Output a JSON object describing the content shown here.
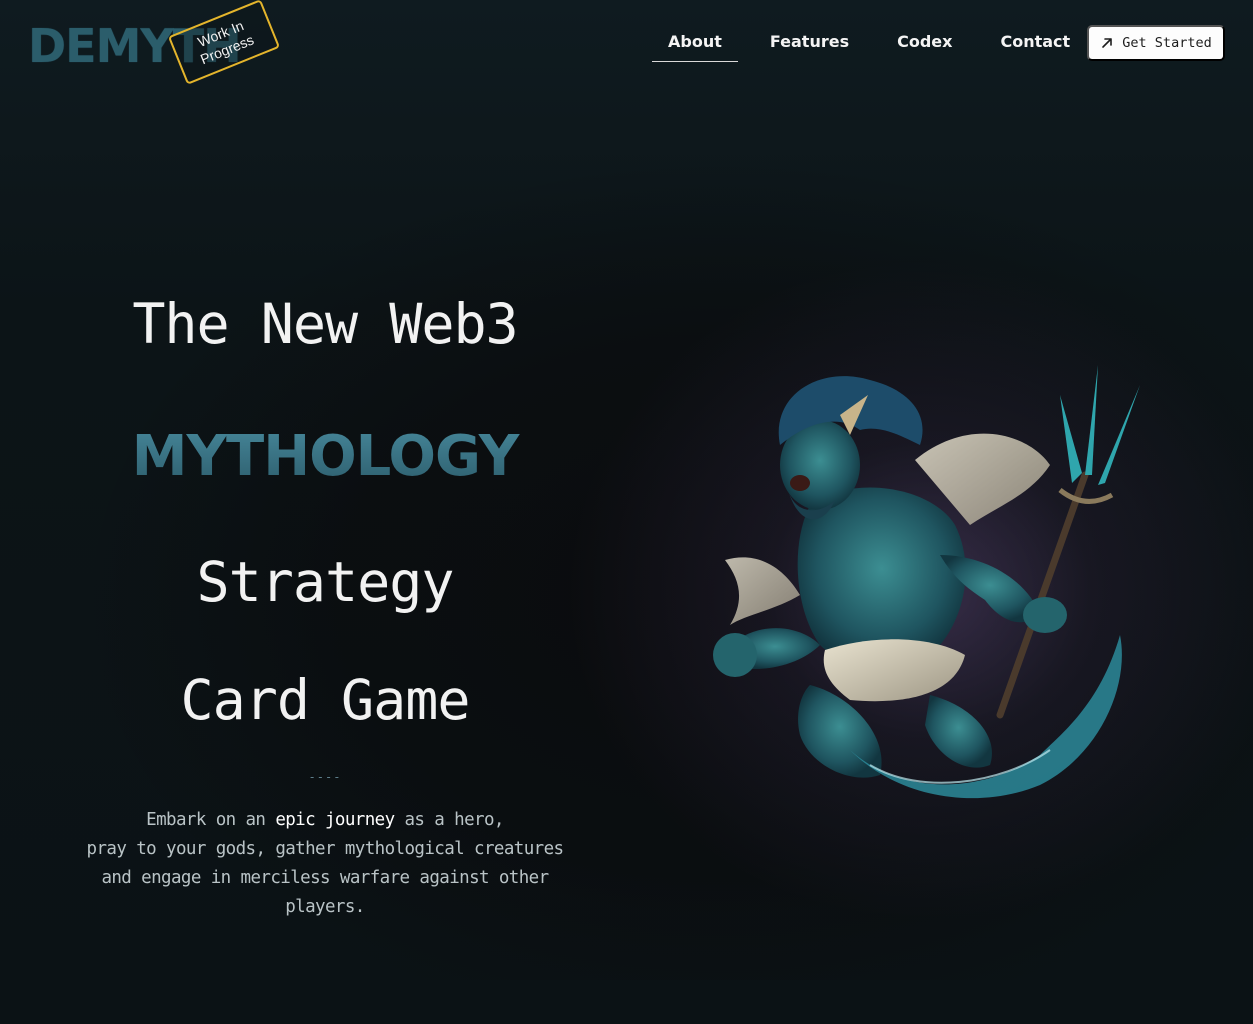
{
  "header": {
    "logo_text": "DEMYTH",
    "wip_line1": "Work In",
    "wip_line2": "Progress",
    "nav": [
      {
        "label": "About",
        "active": true
      },
      {
        "label": "Features",
        "active": false
      },
      {
        "label": "Codex",
        "active": false
      },
      {
        "label": "Contact",
        "active": false
      }
    ],
    "cta_label": "Get Started",
    "cta_icon": "arrow-up-right-icon"
  },
  "hero": {
    "line1": "The New Web3",
    "line2": "MYTHOLOGY",
    "line3": "Strategy",
    "line4": "Card Game",
    "divider": "----",
    "desc_part1": "Embark on an ",
    "desc_highlight": "epic journey",
    "desc_part2": " as a hero,",
    "desc_line2": "pray to your gods, gather mythological creatures",
    "desc_line3": "and engage in merciless warfare against other players.",
    "art": "sea-god-trident-illustration"
  },
  "colors": {
    "background": "#0c1417",
    "logo": "#2b5d6b",
    "badge_border": "#e4b52c",
    "mythology_gradient_top": "#46879a",
    "mythology_gradient_bottom": "#2d5d6c",
    "glow": "#5c4878",
    "cta_bg": "#fdfdfd"
  }
}
